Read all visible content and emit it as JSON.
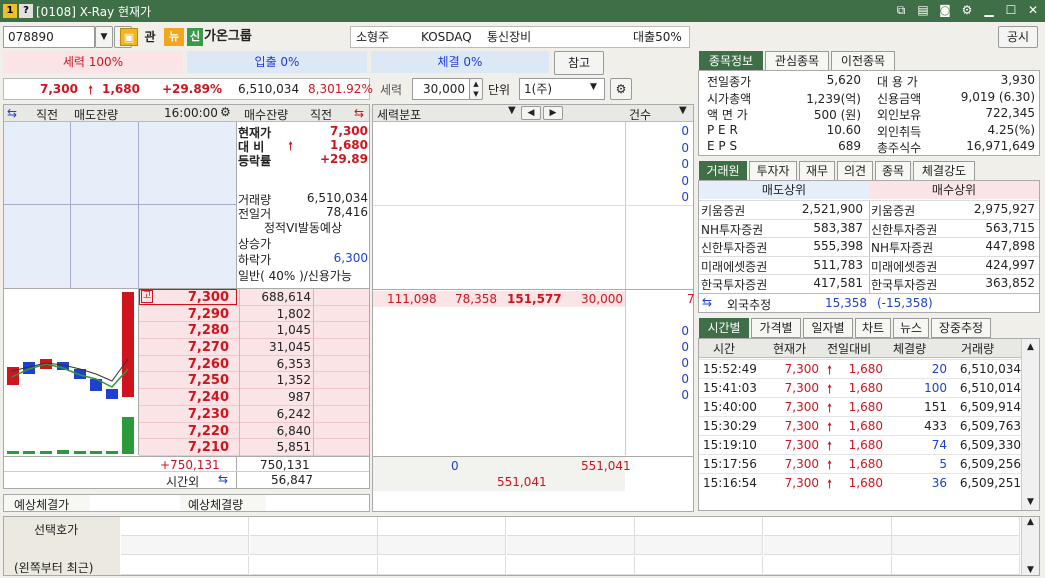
{
  "window": {
    "title": "[0108] X-Ray 현재가"
  },
  "toolbar": {
    "code": "078890",
    "badge_gwan": "관",
    "badge_nyu": "뉴",
    "badge_sin": "신",
    "name": "가온그룹",
    "size": "소형주",
    "market": "KOSDAQ",
    "sector": "통신장비",
    "loan": "대출50%",
    "notice": "공시",
    "ref": "참고"
  },
  "strength": {
    "sellers": "세력 100%",
    "inflow": "입출 0%",
    "exec": "체결 0%"
  },
  "price_line": {
    "price": "7,300",
    "change": "1,680",
    "rate": "+29.89%",
    "volume": "6,510,034",
    "ratio": "8,301.92%"
  },
  "filter": {
    "label": "세력",
    "value": "30,000",
    "unit_label": "단위",
    "unit_value": "1(주)"
  },
  "orderbook": {
    "headers": {
      "c1": "직전",
      "c2": "매도잔량",
      "time": "16:00:00",
      "c4": "매수잔량",
      "c5": "직전"
    },
    "summary": [
      {
        "k": "현재가",
        "v": "7,300"
      },
      {
        "k": "대 비",
        "v": "1,680"
      },
      {
        "k": "등락률",
        "v": "+29.89"
      }
    ],
    "stats": [
      {
        "k": "거래량",
        "v": "6,510,034"
      },
      {
        "k": "전일거",
        "v": "78,416"
      }
    ],
    "vi": "정적VI발동예상",
    "limits": [
      {
        "k": "상승가",
        "v": ""
      },
      {
        "k": "하락가",
        "v": "6,300"
      }
    ],
    "margin": "일반( 40% )/신용가능",
    "bids": [
      {
        "price": "7,300",
        "qty": "688,614"
      },
      {
        "price": "7,290",
        "qty": "1,802"
      },
      {
        "price": "7,280",
        "qty": "1,045"
      },
      {
        "price": "7,270",
        "qty": "31,045"
      },
      {
        "price": "7,260",
        "qty": "6,353"
      },
      {
        "price": "7,250",
        "qty": "1,352"
      },
      {
        "price": "7,240",
        "qty": "987"
      },
      {
        "price": "7,230",
        "qty": "6,242"
      },
      {
        "price": "7,220",
        "qty": "6,840"
      },
      {
        "price": "7,210",
        "qty": "5,851"
      }
    ],
    "total_diff": "+750,131",
    "total_bid": "750,131",
    "after_label": "시간외",
    "after_value": "56,847",
    "expected_price_label": "예상체결가",
    "expected_qty_label": "예상체결량",
    "hi_badge": "고"
  },
  "distribution": {
    "header": "세력분포",
    "count_header": "건수",
    "row": {
      "a": "111,098",
      "b": "78,358",
      "c": "151,577",
      "d": "30,000",
      "e": "7"
    },
    "zeros": [
      "0",
      "0",
      "0",
      "0",
      "0",
      "0",
      "0",
      "0",
      "0",
      "0"
    ],
    "foot_left": "0",
    "foot_right": "551,041",
    "foot_mid": "551,041"
  },
  "info_tabs": [
    "종목정보",
    "관심종목",
    "이전종목"
  ],
  "info": [
    {
      "k1": "전일종가",
      "v1": "5,620",
      "k2": "대 용 가",
      "v2": "3,930"
    },
    {
      "k1": "시가총액",
      "v1": "1,239(억)",
      "k2": "신용금액",
      "v2": "9,019  (6.30)"
    },
    {
      "k1": "액 면 가",
      "v1": "500 (원)",
      "k2": "외인보유",
      "v2": "722,345"
    },
    {
      "k1": "P E R",
      "v1": "10.60",
      "k2": "외인취득",
      "v2": "4.25(%)"
    },
    {
      "k1": "E P S",
      "v1": "689",
      "k2": "총주식수",
      "v2": "16,971,649"
    }
  ],
  "broker_tabs": [
    "거래원",
    "투자자",
    "재무",
    "의견",
    "종목",
    "체결강도"
  ],
  "brokers": {
    "sell_header": "매도상위",
    "buy_header": "매수상위",
    "rows": [
      {
        "s": "키움증권",
        "sv": "2,521,900",
        "b": "키움증권",
        "bv": "2,975,927"
      },
      {
        "s": "NH투자증권",
        "sv": "583,387",
        "b": "신한투자증권",
        "bv": "563,715"
      },
      {
        "s": "신한투자증권",
        "sv": "555,398",
        "b": "NH투자증권",
        "bv": "447,898"
      },
      {
        "s": "미래에셋증권",
        "sv": "511,783",
        "b": "미래에셋증권",
        "bv": "424,997"
      },
      {
        "s": "한국투자증권",
        "sv": "417,581",
        "b": "한국투자증권",
        "bv": "363,852"
      }
    ],
    "foreign_label": "외국추정",
    "foreign_sell": "15,358",
    "foreign_buy": "(-15,358)"
  },
  "time_tabs": [
    "시간별",
    "가격별",
    "일자별",
    "차트",
    "뉴스",
    "장중추정"
  ],
  "ticks": {
    "headers": [
      "시간",
      "현재가",
      "전일대비",
      "체결량",
      "거래량"
    ],
    "rows": [
      {
        "t": "15:52:49",
        "p": "7,300",
        "c": "1,680",
        "q": "20",
        "v": "6,510,034",
        "qc": "blue"
      },
      {
        "t": "15:41:03",
        "p": "7,300",
        "c": "1,680",
        "q": "100",
        "v": "6,510,014",
        "qc": "blue"
      },
      {
        "t": "15:40:00",
        "p": "7,300",
        "c": "1,680",
        "q": "151",
        "v": "6,509,914",
        "qc": "dark"
      },
      {
        "t": "15:30:29",
        "p": "7,300",
        "c": "1,680",
        "q": "433",
        "v": "6,509,763",
        "qc": "dark"
      },
      {
        "t": "15:19:10",
        "p": "7,300",
        "c": "1,680",
        "q": "74",
        "v": "6,509,330",
        "qc": "blue"
      },
      {
        "t": "15:17:56",
        "p": "7,300",
        "c": "1,680",
        "q": "5",
        "v": "6,509,256",
        "qc": "blue"
      },
      {
        "t": "15:16:54",
        "p": "7,300",
        "c": "1,680",
        "q": "36",
        "v": "6,509,251",
        "qc": "blue"
      }
    ]
  },
  "bottom": {
    "label1": "선택호가",
    "label2": "(왼쪽부터 최근)"
  },
  "colors": {
    "title_bar": "#3f6f46",
    "up": "#d0141e",
    "down": "#1f3fd0",
    "ask_bg": "#e6eef9",
    "bid_bg": "#fbe4e6"
  }
}
